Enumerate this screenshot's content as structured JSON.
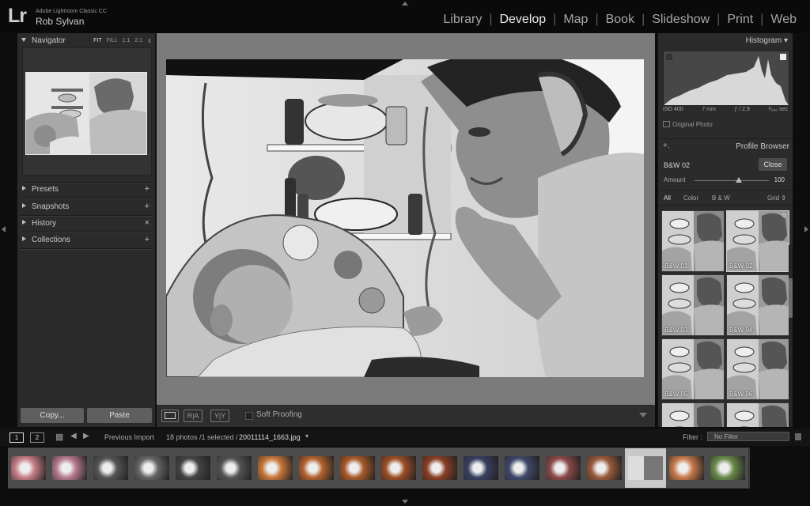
{
  "app": {
    "logo": "Lr",
    "name": "Adobe Lightroom Classic CC",
    "user": "Rob Sylvan"
  },
  "modules": {
    "library": "Library",
    "develop": "Develop",
    "map": "Map",
    "book": "Book",
    "slideshow": "Slideshow",
    "print": "Print",
    "web": "Web",
    "active": "Develop"
  },
  "left_panel": {
    "navigator": {
      "title": "Navigator",
      "zoom": {
        "fit": "FIT",
        "fill": "FILL",
        "one": "1:1",
        "two": "2:1",
        "more": "⇕"
      }
    },
    "presets": {
      "label": "Presets",
      "action": "+"
    },
    "snapshots": {
      "label": "Snapshots",
      "action": "+"
    },
    "history": {
      "label": "History",
      "action": "×"
    },
    "collections": {
      "label": "Collections",
      "action": "+"
    },
    "copy_label": "Copy...",
    "paste_label": "Paste"
  },
  "toolbar": {
    "view_compare": "R|A",
    "view_before_after": "Y|Y",
    "soft_proofing": "Soft Proofing"
  },
  "right_panel": {
    "histogram": {
      "title": "Histogram",
      "iso": "ISO 400",
      "focal": "7 mm",
      "aperture": "ƒ / 2.9",
      "shutter": "¹⁄₁₈₀ sec",
      "original_photo": "Original Photo"
    },
    "profile_browser": {
      "plus": "+.",
      "title": "Profile Browser",
      "current": "B&W 02",
      "close_label": "Close",
      "amount_label": "Amount",
      "amount_value": "100",
      "amount_level": 0.6,
      "filters": {
        "all": "All",
        "color": "Color",
        "bw": "B & W",
        "view": "Grid ⇕"
      },
      "profiles": [
        "B&W 01",
        "B&W 02",
        "B&W 03",
        "B&W 04",
        "B&W 05",
        "B&W 06",
        "",
        ""
      ],
      "selected_index": 1
    }
  },
  "filmstrip": {
    "monitor1": "1",
    "monitor2": "2",
    "source": "Previous Import",
    "info_prefix": "18 photos /1 selected /",
    "filename": "20011114_1663.jpg",
    "filter_label": "Filter :",
    "filter_value": "No Filter",
    "selected_index": 15,
    "thumb_count": 18
  },
  "colors": {
    "background": "#0d0d0d",
    "panel": "#2b2b2b",
    "canvas": "#7b7b7b",
    "active_text": "#ededed"
  }
}
